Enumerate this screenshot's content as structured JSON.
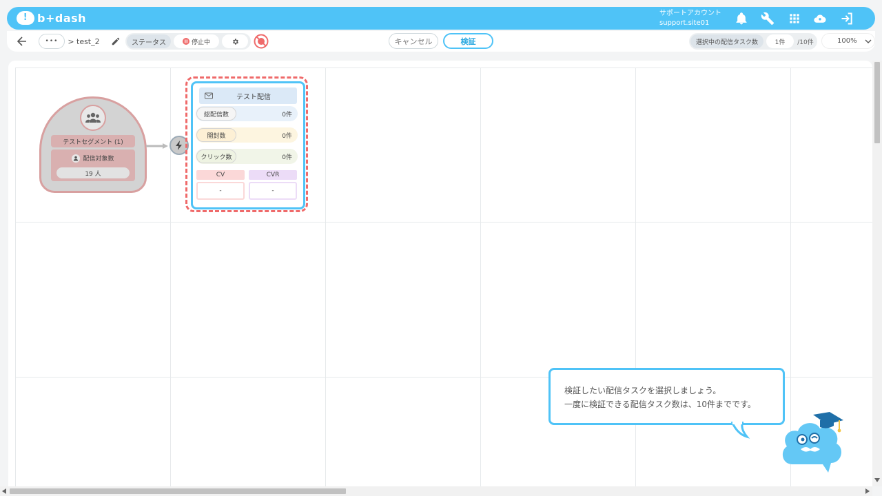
{
  "header": {
    "logo_text": "b+dash",
    "account_name": "サポートアカウント",
    "account_site": "support.site01",
    "icons": [
      "bell-icon",
      "wrench-icon",
      "grid-apps-icon",
      "help-cloud-icon",
      "logout-icon"
    ]
  },
  "toolbar": {
    "back_icon": "arrow-left-icon",
    "menu_dots": "•••",
    "breadcrumb_sep": ">",
    "flow_name": "test_2",
    "status_label": "ステータス",
    "status_value": "停止中",
    "cancel_label": "キャンセル",
    "verify_label": "検証",
    "selected_label": "選択中の配信タスク数",
    "selected_count": "1件",
    "selected_max": "/10件",
    "zoom": "100%",
    "colors": {
      "accent": "#4fc3f7",
      "stopped": "#ef6a6a"
    }
  },
  "canvas": {
    "segment": {
      "title": "テストセグメント (1)",
      "target_label": "配信対象数",
      "target_count": "19 人"
    },
    "task": {
      "title": "テスト配信",
      "metrics": [
        {
          "label": "総配信数",
          "value": "0件",
          "color": "#e8f1fa"
        },
        {
          "label": "開封数",
          "value": "0件",
          "color": "#fdf5e0"
        },
        {
          "label": "クリック数",
          "value": "0件",
          "color": "#f1f5e8"
        }
      ],
      "cv_label": "CV",
      "cv_value": "-",
      "cvr_label": "CVR",
      "cvr_value": "-"
    }
  },
  "tooltip": {
    "line1": "検証したい配信タスクを選択しましょう。",
    "line2": "一度に検証できる配信タスク数は、10件までです。"
  }
}
